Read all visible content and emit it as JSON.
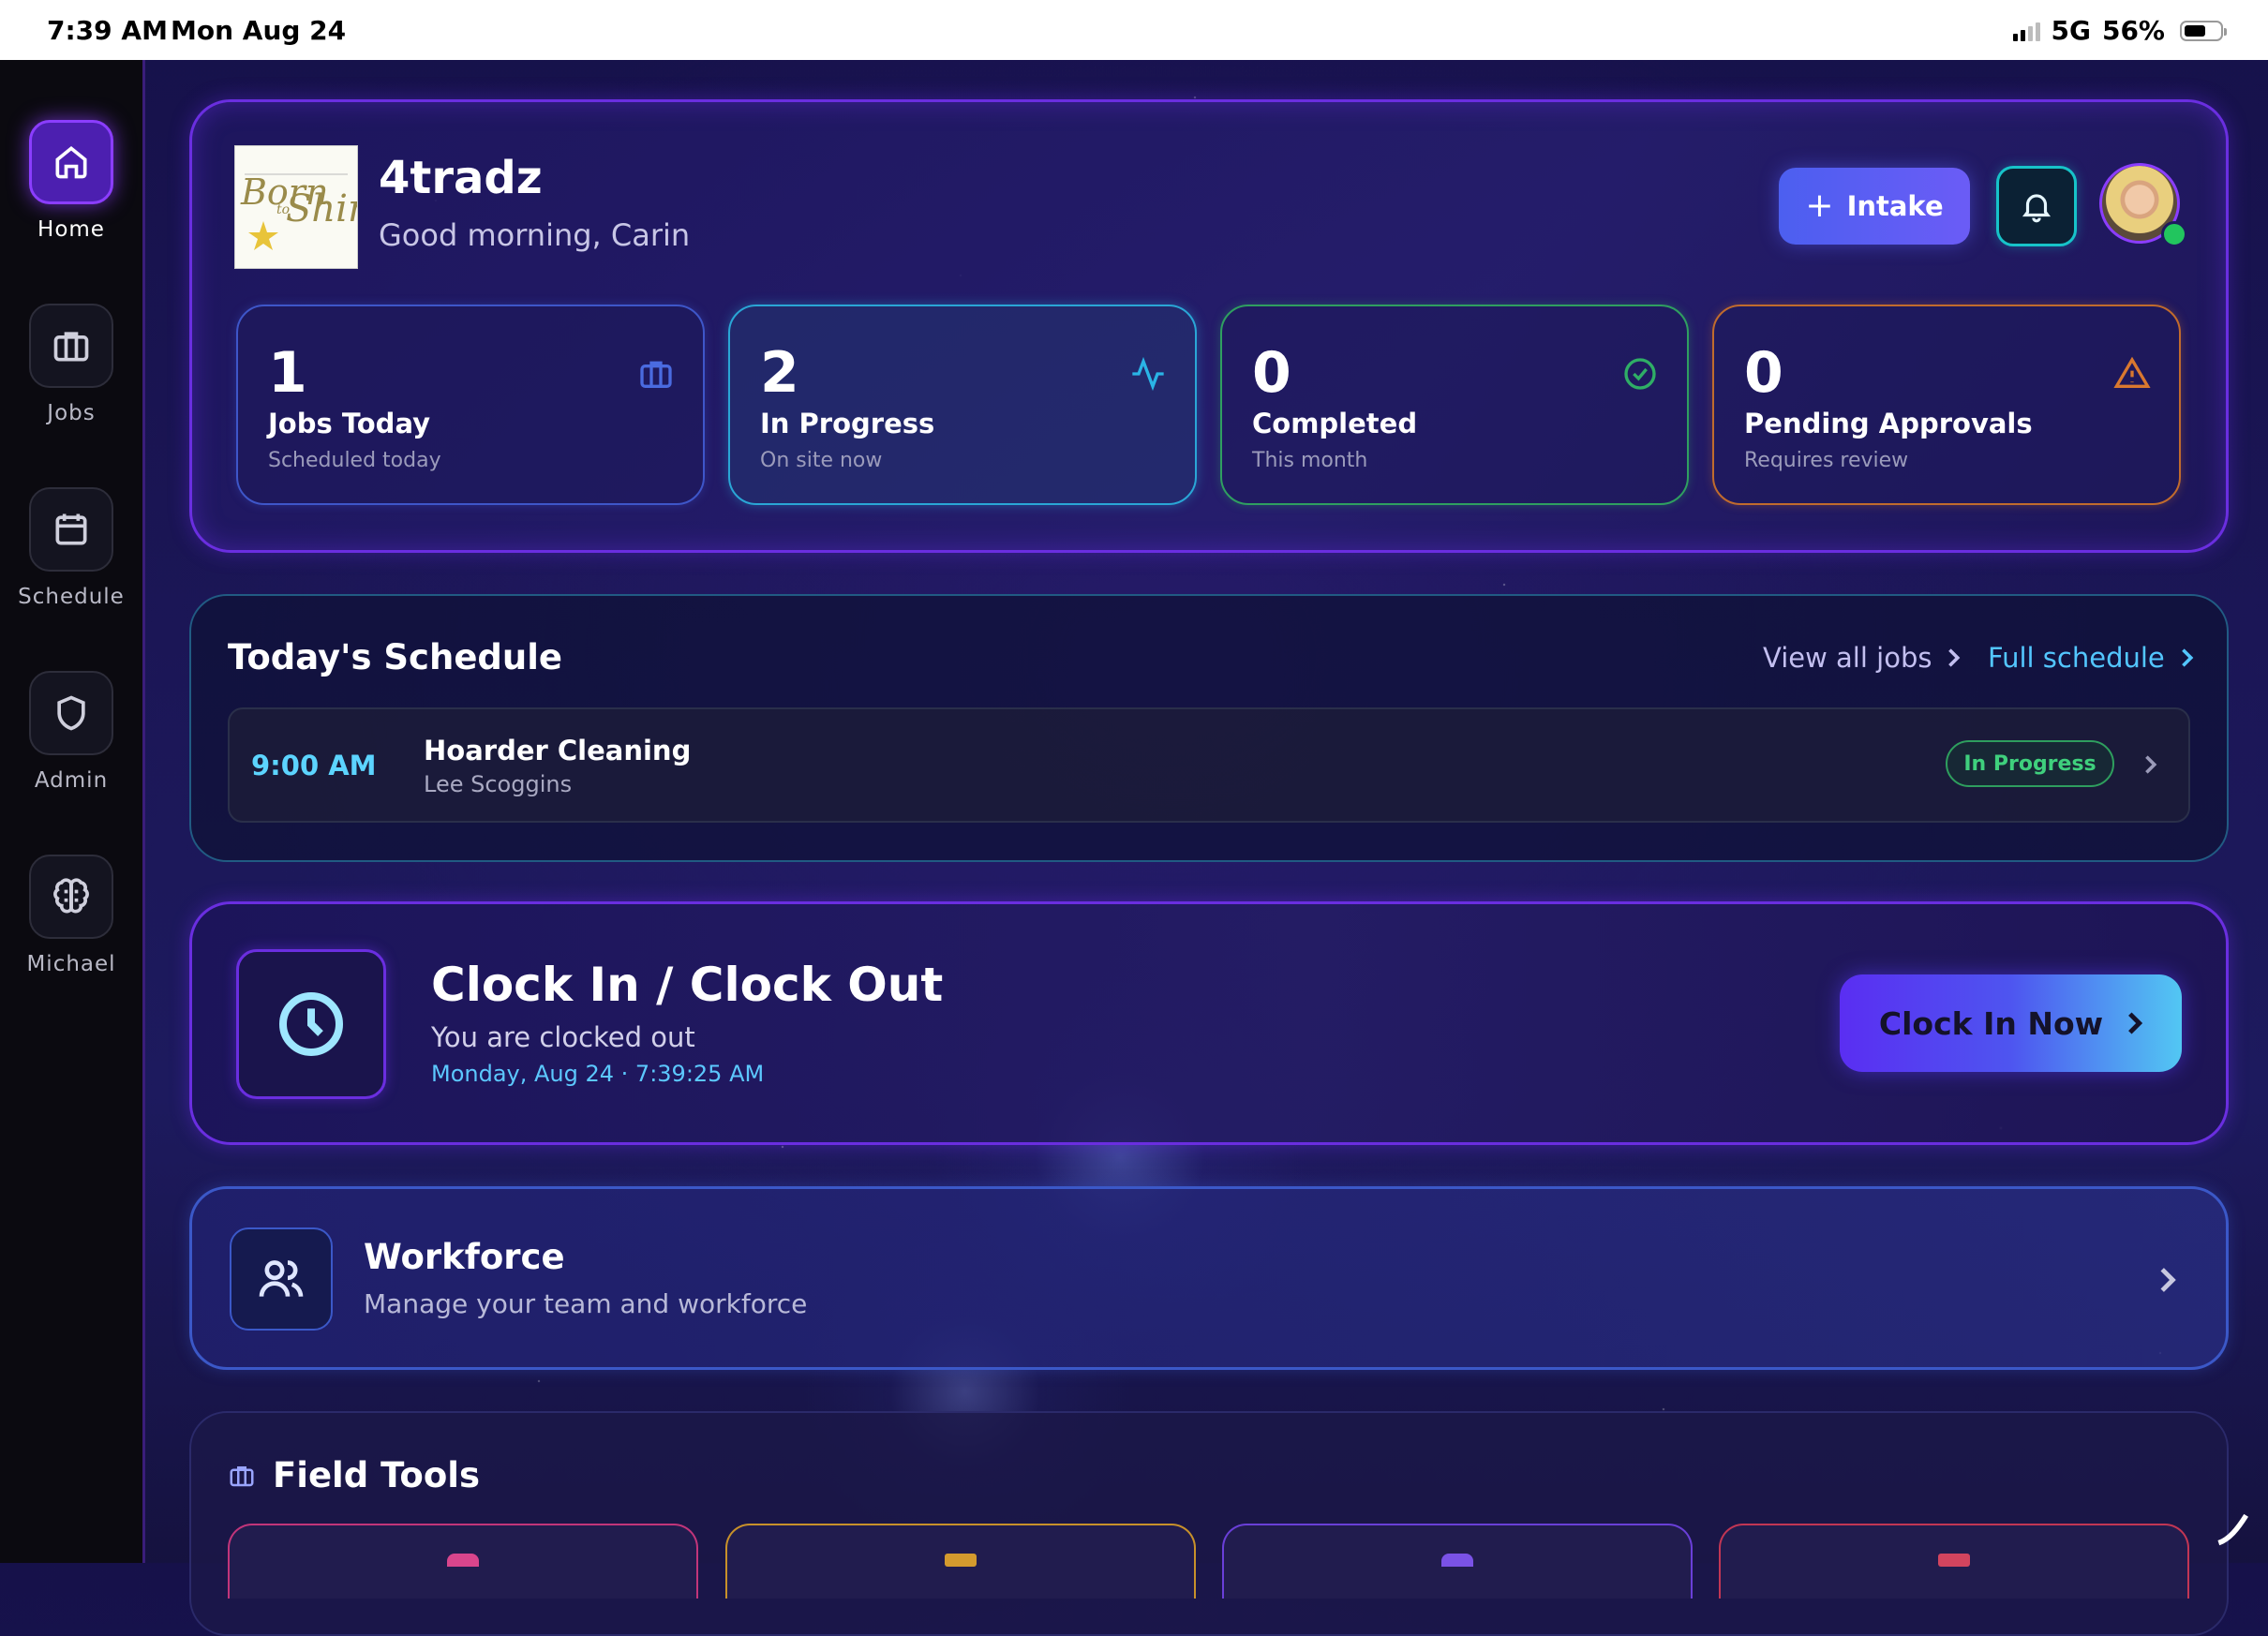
{
  "status_bar": {
    "time": "7:39 AM",
    "date": "Mon Aug 24",
    "network": "5G",
    "battery": "56%",
    "battery_level": 0.56
  },
  "sidebar": {
    "items": [
      {
        "label": "Home",
        "icon": "home-icon",
        "active": true
      },
      {
        "label": "Jobs",
        "icon": "briefcase-icon",
        "active": false
      },
      {
        "label": "Schedule",
        "icon": "calendar-icon",
        "active": false
      },
      {
        "label": "Admin",
        "icon": "shield-icon",
        "active": false
      },
      {
        "label": "Michael",
        "icon": "brain-icon",
        "active": false
      }
    ]
  },
  "header": {
    "company": "4tradz",
    "greeting": "Good morning, Carin",
    "intake_label": "Intake",
    "logo_text": "Born to Shine"
  },
  "stats": [
    {
      "value": "1",
      "title": "Jobs Today",
      "subtitle": "Scheduled today",
      "icon": "briefcase-icon",
      "color": "#3e56c9"
    },
    {
      "value": "2",
      "title": "In Progress",
      "subtitle": "On site now",
      "icon": "activity-icon",
      "color": "#2aa6d6"
    },
    {
      "value": "0",
      "title": "Completed",
      "subtitle": "This month",
      "icon": "check-circle-icon",
      "color": "#2f9f60"
    },
    {
      "value": "0",
      "title": "Pending Approvals",
      "subtitle": "Requires review",
      "icon": "alert-triangle-icon",
      "color": "#c16b2d"
    }
  ],
  "schedule": {
    "title": "Today's Schedule",
    "view_all_label": "View all jobs",
    "full_schedule_label": "Full schedule",
    "jobs": [
      {
        "time": "9:00 AM",
        "name": "Hoarder Cleaning",
        "person": "Lee Scoggins",
        "status": "In Progress"
      }
    ]
  },
  "clock": {
    "title": "Clock In / Clock Out",
    "status": "You are clocked out",
    "datetime": "Monday, Aug 24 · 7:39:25 AM",
    "button_label": "Clock In Now"
  },
  "workforce": {
    "title": "Workforce",
    "subtitle": "Manage your team and workforce"
  },
  "field_tools": {
    "title": "Field Tools"
  },
  "colors": {
    "accent": "#6a2ee0",
    "cyan": "#53c6ff",
    "success": "#3fd07d"
  }
}
